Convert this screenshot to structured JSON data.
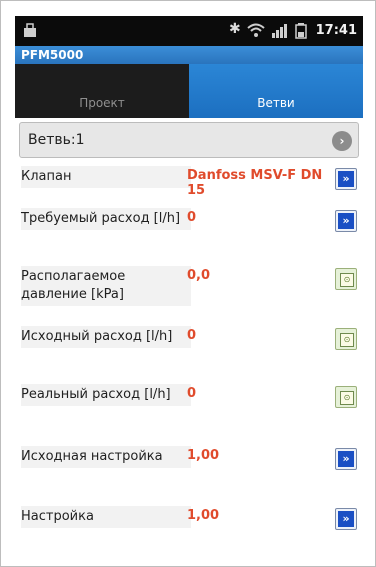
{
  "statusbar": {
    "time": "17:41"
  },
  "app": {
    "title": "PFM5000"
  },
  "tabs": [
    {
      "label": "Проект"
    },
    {
      "label": "Ветви"
    }
  ],
  "branch_selector": {
    "label": "Ветвь:1"
  },
  "rows": [
    {
      "label": "Клапан",
      "value": "Danfoss MSV-F DN 15",
      "button_icon": "double-arrow-right-icon"
    },
    {
      "label": "Требуемый расход [l/h]",
      "value": "0",
      "button_icon": "double-arrow-right-icon"
    },
    {
      "label": "Располагаемое давление [kPa]",
      "value": "0,0",
      "button_icon": "calculator-icon"
    },
    {
      "label": "Исходный расход [l/h]",
      "value": "0",
      "button_icon": "calculator-icon"
    },
    {
      "label": "Реальный расход [l/h]",
      "value": "0",
      "button_icon": "calculator-icon"
    },
    {
      "label": "Исходная настройка",
      "value": "1,00",
      "button_icon": "double-arrow-right-icon"
    },
    {
      "label": "Настройка",
      "value": "1,00",
      "button_icon": "double-arrow-right-icon"
    }
  ]
}
